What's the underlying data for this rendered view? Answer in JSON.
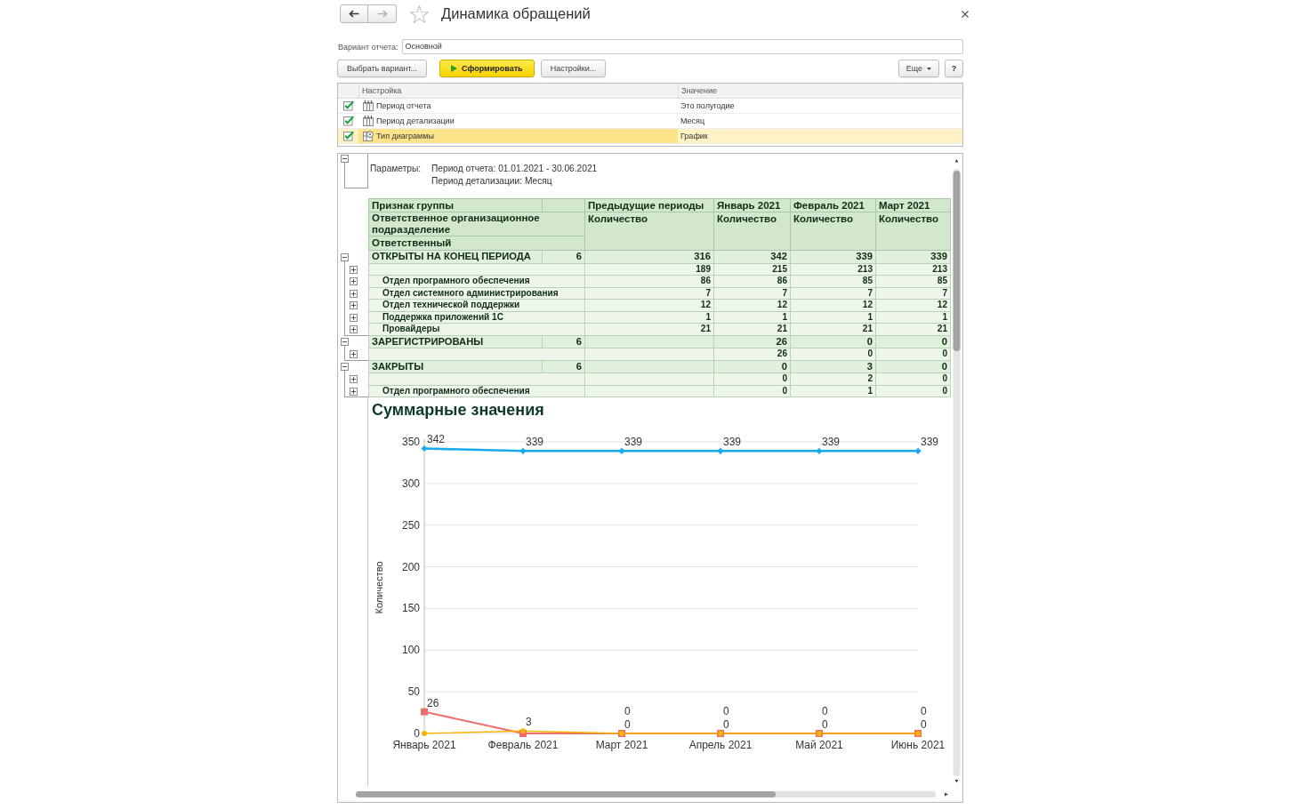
{
  "window": {
    "title": "Динамика обращений",
    "favorite": false,
    "nav": [
      {
        "kind": "back",
        "disabled": false
      },
      {
        "kind": "forward",
        "disabled": true
      }
    ]
  },
  "variant": {
    "label": "Вариант отчета:",
    "value": "Основной"
  },
  "toolbar": {
    "left": [
      {
        "kind": "plain",
        "label": "Выбрать вариант..."
      },
      {
        "kind": "primary",
        "label": "Сформировать"
      },
      {
        "kind": "plain",
        "label": "Настройки..."
      }
    ],
    "right": [
      {
        "kind": "menu",
        "label": "Еще"
      },
      {
        "kind": "help",
        "label": "?"
      }
    ]
  },
  "settings": {
    "columns": [
      "Настройка",
      "Значение"
    ],
    "rows": [
      {
        "kind": "period",
        "checked": true,
        "name": "Период отчета",
        "value": "Это полугодие",
        "selected": false
      },
      {
        "kind": "period",
        "checked": true,
        "name": "Период детализации",
        "value": "Месяц",
        "selected": false
      },
      {
        "kind": "chart",
        "checked": true,
        "name": "Тип диаграммы",
        "value": "График",
        "selected": true
      }
    ]
  },
  "report": {
    "expanded": true,
    "parameters_label": "Параметры:",
    "parameters": [
      "Период отчета: 01.01.2021 - 30.06.2021",
      "Период детализации: Месяц"
    ],
    "table": {
      "group_headers": [
        "Признак группы",
        "Ответственное организационное подразделение",
        "Ответственный"
      ],
      "previous_column": {
        "period": "Предыдущие периоды",
        "measure": "Количество"
      },
      "month_columns": [
        {
          "period": "Январь 2021",
          "measure": "Количество"
        },
        {
          "period": "Февраль 2021",
          "measure": "Количество"
        },
        {
          "period": "Март 2021",
          "measure": "Количество"
        }
      ],
      "groups": [
        {
          "label": "ОТКРЫТЫ НА КОНЕЦ ПЕРИОДА",
          "count": "6",
          "previous": "316",
          "months": [
            "342",
            "339",
            "339"
          ],
          "expanded": true,
          "children": [
            {
              "previous": "189",
              "months": [
                "215",
                "213",
                "213"
              ],
              "expanded": false
            },
            {
              "label": "Отдел програмного обеспечения",
              "previous": "86",
              "months": [
                "86",
                "85",
                "85"
              ],
              "expanded": false
            },
            {
              "label": "Отдел системного администрирования",
              "previous": "7",
              "months": [
                "7",
                "7",
                "7"
              ],
              "expanded": false
            },
            {
              "label": "Отдел технической поддержки",
              "previous": "12",
              "months": [
                "12",
                "12",
                "12"
              ],
              "expanded": false
            },
            {
              "label": "Поддержка приложений 1С",
              "previous": "1",
              "months": [
                "1",
                "1",
                "1"
              ],
              "expanded": false
            },
            {
              "label": "Провайдеры",
              "previous": "21",
              "months": [
                "21",
                "21",
                "21"
              ],
              "expanded": false
            }
          ]
        },
        {
          "label": "ЗАРЕГИСТРИРОВАНЫ",
          "count": "6",
          "months": [
            "26",
            "0",
            "0"
          ],
          "expanded": true,
          "children": [
            {
              "months": [
                "26",
                "0",
                "0"
              ],
              "expanded": false
            }
          ]
        },
        {
          "label": "ЗАКРЫТЫ",
          "count": "6",
          "months": [
            "0",
            "3",
            "0"
          ],
          "expanded": true,
          "children": [
            {
              "months": [
                "0",
                "2",
                "0"
              ],
              "expanded": false
            },
            {
              "label": "Отдел програмного обеспечения",
              "months": [
                "0",
                "1",
                "0"
              ],
              "expanded": false
            }
          ]
        }
      ]
    },
    "chart_data": {
      "type": "line",
      "title": "Суммарные значения",
      "ylabel": "Количество",
      "categories": [
        "Январь 2021",
        "Февраль 2021",
        "Март 2021",
        "Апрель 2021",
        "Май 2021",
        "Июнь 2021"
      ],
      "series": [
        {
          "color": "#19a9ec",
          "marker": "diamond",
          "values": [
            342,
            339,
            339,
            339,
            339,
            339
          ]
        },
        {
          "color": "#f36b6b",
          "marker": "square",
          "values": [
            26,
            0,
            0,
            0,
            0,
            0
          ]
        },
        {
          "color": "#f6b400",
          "marker": "circle",
          "values": [
            0,
            3,
            0,
            0,
            0,
            0
          ]
        }
      ],
      "ylim": [
        0,
        350
      ],
      "yticks": [
        0,
        50,
        100,
        150,
        200,
        250,
        300,
        350
      ],
      "grid": true,
      "value_labels": [
        [
          "342",
          "339",
          "339",
          "339",
          "339",
          "339"
        ],
        [
          "26",
          null,
          "0",
          "0",
          "0",
          "0"
        ],
        [
          null,
          "3",
          "0",
          "0",
          "0",
          "0"
        ]
      ]
    }
  }
}
